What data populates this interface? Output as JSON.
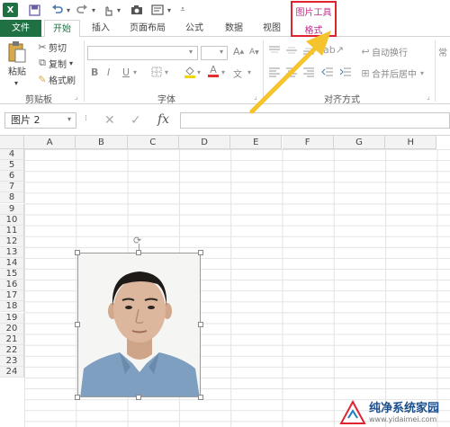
{
  "qat": {
    "app_logo": "X",
    "icons": [
      "excel-logo-icon",
      "save-icon",
      "undo-icon",
      "redo-icon",
      "touch-mode-icon",
      "camera-icon",
      "form-icon",
      "customize-qat-icon"
    ]
  },
  "context_tab": {
    "group_title": "图片工具",
    "tab_label": "格式",
    "highlight_color": "#e0242f",
    "title_color": "#c22a8b"
  },
  "tabs": {
    "file": "文件",
    "home": "开始",
    "insert": "插入",
    "page_layout": "页面布局",
    "formulas": "公式",
    "data": "数据",
    "view": "视图"
  },
  "ribbon": {
    "clipboard": {
      "paste": "粘贴",
      "cut": "剪切",
      "copy": "复制",
      "format_painter": "格式刷",
      "group_label": "剪贴板"
    },
    "font": {
      "bold": "B",
      "italic": "I",
      "underline": "U",
      "grow": "A",
      "shrink": "A",
      "group_label": "字体"
    },
    "alignment": {
      "wrap_text": "自动换行",
      "merge_center": "合并后居中",
      "group_label": "对齐方式"
    },
    "number": {
      "format_partial": "常"
    }
  },
  "formula_bar": {
    "name_box": "图片 2",
    "cancel": "✕",
    "enter": "✓",
    "fx": "fx",
    "formula": ""
  },
  "grid": {
    "columns": [
      "A",
      "B",
      "C",
      "D",
      "E",
      "F",
      "G",
      "H"
    ],
    "rows": [
      "4",
      "5",
      "6",
      "7",
      "8",
      "9",
      "10",
      "11",
      "12",
      "13",
      "14",
      "15",
      "16",
      "17",
      "18",
      "19",
      "20",
      "21",
      "22",
      "23",
      "24"
    ]
  },
  "watermark": {
    "text": "纯净系统家园",
    "url": "www.yidaimei.com"
  },
  "colors": {
    "excel_green": "#1f7144",
    "arrow": "#f5c42c"
  }
}
